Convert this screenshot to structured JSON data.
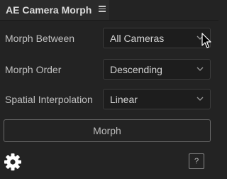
{
  "panel": {
    "title": "AE Camera Morph",
    "menu_icon": "hamburger-menu-icon"
  },
  "rows": [
    {
      "label": "Morph Between",
      "value": "All Cameras"
    },
    {
      "label": "Morph Order",
      "value": "Descending"
    },
    {
      "label": "Spatial Interpolation",
      "value": "Linear"
    }
  ],
  "morph_button": {
    "label": "Morph"
  },
  "footer": {
    "settings_icon": "gear-icon",
    "help_label": "?"
  },
  "colors": {
    "background": "#232323",
    "field_background": "#1d1d1d",
    "text": "#c8c8c8"
  }
}
